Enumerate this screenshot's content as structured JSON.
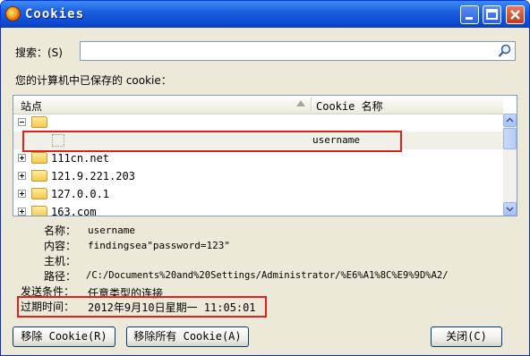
{
  "window": {
    "title": "Cookies"
  },
  "search": {
    "label": "搜索：(S)",
    "value": "",
    "placeholder": ""
  },
  "list_caption": "您的计算机中已保存的 cookie：",
  "tree": {
    "columns": {
      "site": "站点",
      "cookie_name": "Cookie 名称"
    },
    "rows": [
      {
        "kind": "folder-open",
        "label": ""
      },
      {
        "kind": "cookie",
        "label": "",
        "cookie_name": "username"
      },
      {
        "kind": "folder",
        "label": "111cn.net"
      },
      {
        "kind": "folder",
        "label": "121.9.221.203"
      },
      {
        "kind": "folder",
        "label": "127.0.0.1"
      },
      {
        "kind": "folder",
        "label": "163.com"
      }
    ]
  },
  "details": {
    "name_label": "名称：",
    "name_value": "username",
    "content_label": "内容：",
    "content_value": "findingsea\"password=123\"",
    "host_label": "主机：",
    "host_value": "",
    "path_label": "路径：",
    "path_value": "/C:/Documents%20and%20Settings/Administrator/%E6%A1%8C%E9%9D%A2/",
    "send_label": "发送条件：",
    "send_value": "任意类型的连接",
    "expire_label": "过期时间：",
    "expire_value": "2012年9月10日星期一 11:05:01"
  },
  "buttons": {
    "remove": "移除 Cookie(R)",
    "remove_all": "移除所有 Cookie(A)",
    "close": "关闭(C)"
  },
  "colors": {
    "titlebar": "#0a49d0",
    "highlight_box": "#e0201b"
  }
}
